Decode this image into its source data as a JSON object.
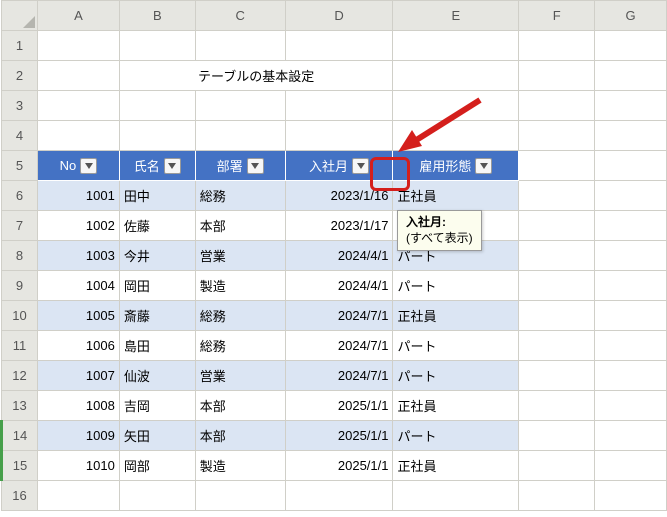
{
  "columns": {
    "A": "A",
    "B": "B",
    "C": "C",
    "D": "D",
    "E": "E",
    "F": "F",
    "G": "G"
  },
  "rowLabels": [
    "1",
    "2",
    "3",
    "4",
    "5",
    "6",
    "7",
    "8",
    "9",
    "10",
    "11",
    "12",
    "13",
    "14",
    "15",
    "16"
  ],
  "title": "テーブルの基本設定",
  "headers": {
    "no": "No",
    "name": "氏名",
    "dept": "部署",
    "joined": "入社月",
    "emptype": "雇用形態"
  },
  "rows": [
    {
      "no": "1001",
      "name": "田中",
      "dept": "総務",
      "joined": "2023/1/16",
      "emptype": "正社員"
    },
    {
      "no": "1002",
      "name": "佐藤",
      "dept": "本部",
      "joined": "2023/1/17",
      "emptype": ""
    },
    {
      "no": "1003",
      "name": "今井",
      "dept": "営業",
      "joined": "2024/4/1",
      "emptype": "パート"
    },
    {
      "no": "1004",
      "name": "岡田",
      "dept": "製造",
      "joined": "2024/4/1",
      "emptype": "パート"
    },
    {
      "no": "1005",
      "name": "斎藤",
      "dept": "総務",
      "joined": "2024/7/1",
      "emptype": "正社員"
    },
    {
      "no": "1006",
      "name": "島田",
      "dept": "総務",
      "joined": "2024/7/1",
      "emptype": "パート"
    },
    {
      "no": "1007",
      "name": "仙波",
      "dept": "営業",
      "joined": "2024/7/1",
      "emptype": "パート"
    },
    {
      "no": "1008",
      "name": "吉岡",
      "dept": "本部",
      "joined": "2025/1/1",
      "emptype": "正社員"
    },
    {
      "no": "1009",
      "name": "矢田",
      "dept": "本部",
      "joined": "2025/1/1",
      "emptype": "パート"
    },
    {
      "no": "1010",
      "name": "岡部",
      "dept": "製造",
      "joined": "2025/1/1",
      "emptype": "正社員"
    }
  ],
  "tooltip": {
    "title": "入社月:",
    "body": "(すべて表示)"
  }
}
